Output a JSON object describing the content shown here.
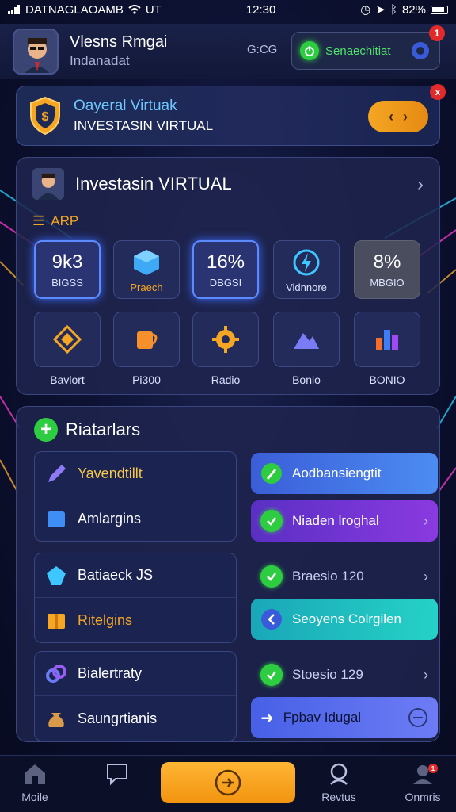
{
  "status_bar": {
    "carrier": "DATNAGLAOAMB",
    "network": "UT",
    "time": "12:30",
    "battery": "82%"
  },
  "header": {
    "user_name": "Vlesns Rmgai",
    "user_sub": "Indanadat",
    "code": "G:CG",
    "status_label": "Senaechitiat",
    "notification_count": "1"
  },
  "banner": {
    "title": "Oayeral Virtuak",
    "subtitle": "INVESTASIN VIRTUAL",
    "close": "x"
  },
  "investment": {
    "title": "Investasin VIRTUAL",
    "section_label": "ARP",
    "tiles_top": [
      {
        "big": "9k3",
        "small": "BIGSS"
      },
      {
        "big": "",
        "small": "Praech"
      },
      {
        "big": "16%",
        "small": "DBGSI"
      },
      {
        "big": "",
        "small": "Vidnnore"
      },
      {
        "big": "8%",
        "small": "MBGIO"
      }
    ],
    "tiles_bottom": [
      {
        "label": "Bavlort"
      },
      {
        "label": "Pi300"
      },
      {
        "label": "Radio"
      },
      {
        "label": "Bonio"
      },
      {
        "label": "BONIO"
      }
    ]
  },
  "actions": {
    "title": "Riatarlars",
    "group1": [
      "Yavendtillt",
      "Amlargins"
    ],
    "group2": [
      "Batiaeck JS",
      "Ritelgins"
    ],
    "group3": [
      "Bialertraty",
      "Saungrtianis"
    ],
    "right": [
      {
        "label": "Aodbansiengtit"
      },
      {
        "label": "Niaden lroghal"
      },
      {
        "label": "Braesio 120"
      },
      {
        "label": "Seoyens Colrgilen"
      },
      {
        "label": "Stoesio 129"
      },
      {
        "label": "Fpbav Idugal"
      }
    ]
  },
  "bottom_nav": {
    "home": "Moile",
    "messages": "",
    "search": "Revtus",
    "account": "Onmris",
    "account_badge": "1"
  }
}
